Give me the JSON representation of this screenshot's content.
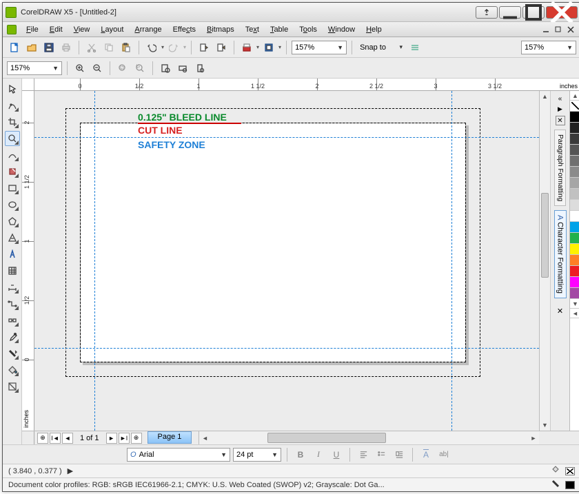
{
  "window": {
    "title": "CorelDRAW X5 - [Untitled-2]"
  },
  "menu": {
    "items": [
      {
        "label": "File",
        "accel": "F"
      },
      {
        "label": "Edit",
        "accel": "E"
      },
      {
        "label": "View",
        "accel": "V"
      },
      {
        "label": "Layout",
        "accel": "L"
      },
      {
        "label": "Arrange",
        "accel": "A"
      },
      {
        "label": "Effects",
        "accel": "c"
      },
      {
        "label": "Bitmaps",
        "accel": "B"
      },
      {
        "label": "Text",
        "accel": "x"
      },
      {
        "label": "Table",
        "accel": "T"
      },
      {
        "label": "Tools",
        "accel": "o"
      },
      {
        "label": "Window",
        "accel": "W"
      },
      {
        "label": "Help",
        "accel": "H"
      }
    ]
  },
  "toolbar1": {
    "zoom1": "157%",
    "snapto": "Snap to",
    "zoom2": "157%"
  },
  "toolbar2": {
    "zoom": "157%"
  },
  "ruler": {
    "unit": "inches",
    "h_ticks": [
      "0",
      "1/2",
      "1",
      "1 1/2",
      "2",
      "2 1/2",
      "3",
      "3 1/2"
    ],
    "v_ticks": [
      "2",
      "1 1/2",
      "1",
      "1/2",
      "0"
    ]
  },
  "canvas": {
    "labels": {
      "bleed": "0.125\" BLEED LINE",
      "cut": "CUT LINE",
      "safety": "SAFETY ZONE"
    },
    "colors": {
      "bleed": "#0a8a2c",
      "cut": "#d61f1f",
      "safety": "#1d7fd6"
    }
  },
  "docker": {
    "tabs": [
      "Paragraph Formatting",
      "Character Formatting"
    ]
  },
  "palette": {
    "swatches": [
      "#000000",
      "#222222",
      "#3a3a3a",
      "#555555",
      "#707070",
      "#8b8b8b",
      "#a6a6a6",
      "#c1c1c1",
      "#dcdcdc",
      "#ffffff",
      "#00a2e8",
      "#22b14c",
      "#fff200",
      "#ff7f27",
      "#ed1c24",
      "#ff00ff",
      "#a349a4"
    ]
  },
  "pagenav": {
    "count_label": "1 of 1",
    "page_tab": "Page 1"
  },
  "propbar": {
    "font": "Arial",
    "size": "24 pt"
  },
  "status1": {
    "coords": "( 3.840 , 0.377 )"
  },
  "status2": {
    "profiles": "Document color profiles: RGB: sRGB IEC61966-2.1; CMYK: U.S. Web Coated (SWOP) v2; Grayscale: Dot Ga..."
  }
}
